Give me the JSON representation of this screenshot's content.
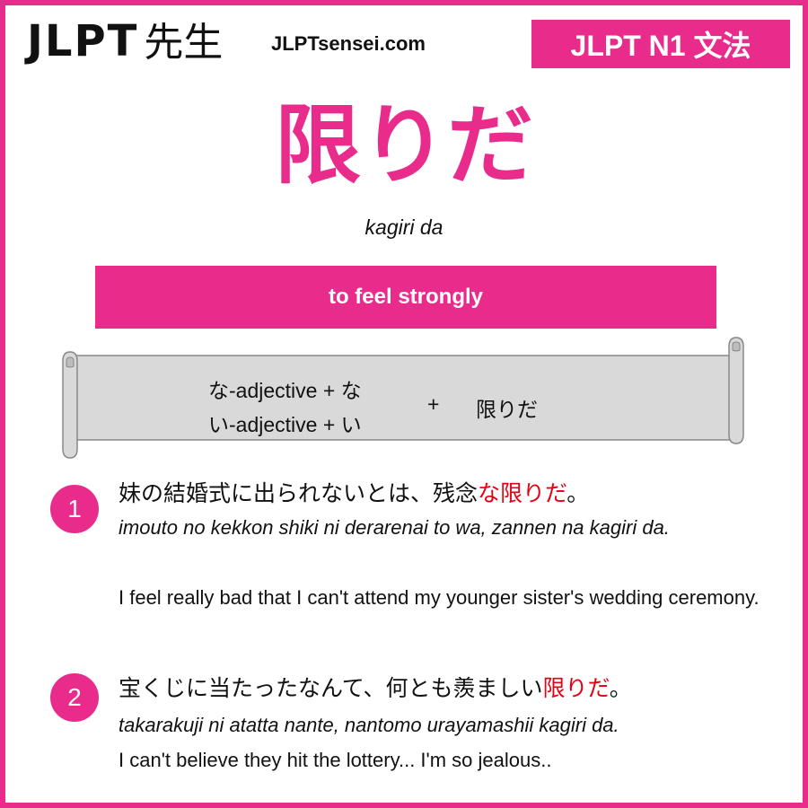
{
  "header": {
    "logo_text": "JLPT",
    "logo_kanji": "先生",
    "site": "JLPTsensei.com",
    "level": "JLPT N1 文法"
  },
  "grammar": {
    "title": "限りだ",
    "romaji": "kagiri da",
    "meaning": "to feel strongly"
  },
  "formation": {
    "line1": "な-adjective + な",
    "line2": "い-adjective + い",
    "plus": "+",
    "ending": "限りだ"
  },
  "examples": [
    {
      "number": "1",
      "jp_before": "妹の結婚式に出られないとは、残念",
      "jp_highlight": "な限りだ",
      "jp_after": "。",
      "romaji": "imouto no kekkon shiki ni derarenai to wa, zannen na kagiri da.",
      "english": "I feel really bad that I can't attend my younger sister's wedding ceremony."
    },
    {
      "number": "2",
      "jp_before": "宝くじに当たったなんて、何とも羨ましい",
      "jp_highlight": "限りだ",
      "jp_after": "。",
      "romaji": "takarakuji ni atatta nante, nantomo urayamashii kagiri da.",
      "english": "I can't believe they hit the lottery... I'm so jealous.."
    }
  ],
  "colors": {
    "accent": "#e92b8c",
    "highlight": "#e60012",
    "scroll_fill": "#d9d9d9"
  }
}
